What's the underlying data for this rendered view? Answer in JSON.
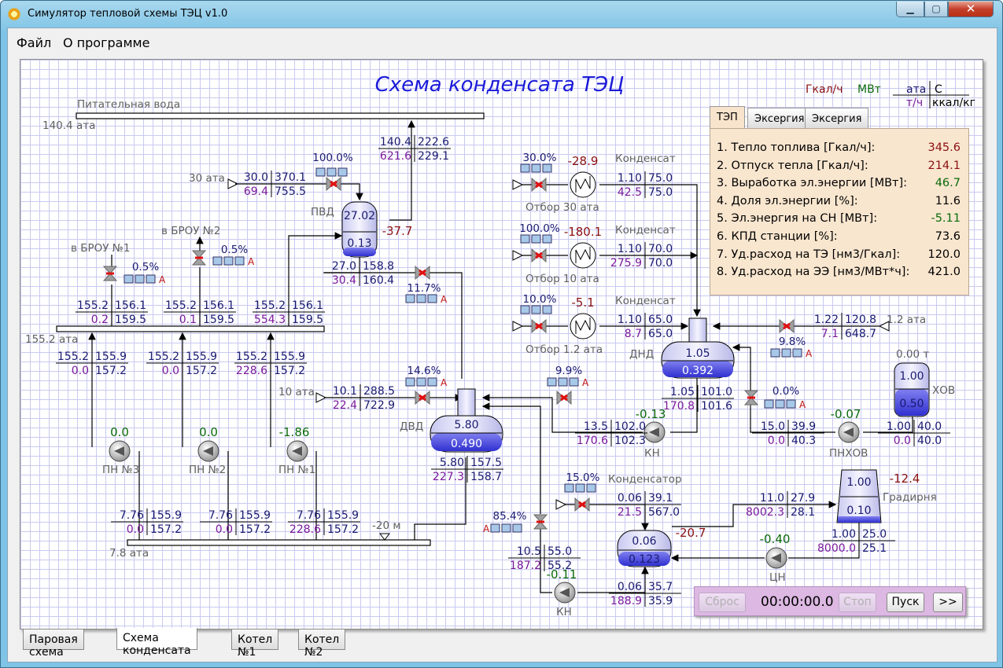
{
  "window": {
    "title": "Симулятор тепловой схемы ТЭЦ v1.0",
    "min": "▁",
    "max": "▢",
    "close": "✕"
  },
  "menu": [
    "Файл",
    "О программе"
  ],
  "diagram": {
    "title": "Схема конденсата ТЭЦ",
    "units": {
      "gcal": "Гкал/ч",
      "mw": "МВт",
      "ata": "ата",
      "c": "С",
      "th": "т/ч",
      "kcal": "ккал/кг"
    },
    "labels": {
      "feed_water": "Питательная вода",
      "p140": "140.4 ата",
      "p30": "30 ата",
      "pvd": "ПВД",
      "brou1": "в БРОУ №1",
      "brou2": "в БРОУ №2",
      "p155": "155.2 ата",
      "p10": "10 ата",
      "dvd": "ДВД",
      "pn3": "ПН №3",
      "pn2": "ПН №2",
      "pn1": "ПН №1",
      "p78": "7.8 ата",
      "m20": "-20 м",
      "cond_a": "Конденсат",
      "cond_b": "Конденсат",
      "cond_c": "Конденсат",
      "otb30": "Отбор 30 ата",
      "otb10": "Отбор 10 ата",
      "otb12": "Отбор 1.2 ата",
      "dnd": "ДНД",
      "kn1": "КН",
      "kn2": "КН",
      "p12": "1.2 ата",
      "hov": "ХОВ",
      "t0": "0.00 т",
      "pnhov": "ПНХОВ",
      "condenser": "Конденсатор",
      "gradirnya": "Градирня",
      "cn": "ЦН",
      "A": "А"
    },
    "values": {
      "v_100a": "100.0%",
      "v_30a": "30.0",
      "v_370": "370.1",
      "v_694": "69.4",
      "v_755": "755.5",
      "v_1404": "140.4",
      "v_2226": "222.6",
      "v_6216": "621.6",
      "v_2291": "229.1",
      "pvd_top": "27.02",
      "pvd_bot": "0.13",
      "v_m377": "-37.7",
      "v_270": "27.0",
      "v_1588": "158.8",
      "v_304": "30.4",
      "v_1604": "160.4",
      "v_117": "11.7%",
      "v_05a": "0.5%",
      "v_05b": "0.5%",
      "h1a": "155.2",
      "h1b": "156.1",
      "h1c": "0.2",
      "h1d": "159.5",
      "h2a": "155.2",
      "h2b": "156.1",
      "h2c": "0.1",
      "h2d": "159.5",
      "h3a": "155.2",
      "h3b": "156.1",
      "h3c": "554.3",
      "h3d": "159.5",
      "g1a": "155.2",
      "g1b": "155.9",
      "g1c": "0.0",
      "g1d": "157.2",
      "g2a": "155.2",
      "g2b": "155.9",
      "g2c": "0.0",
      "g2d": "157.2",
      "g3a": "155.2",
      "g3b": "155.9",
      "g3c": "228.6",
      "g3d": "157.2",
      "pn3v": "0.0",
      "pn2v": "0.0",
      "pn1v": "-1.86",
      "b1a": "7.76",
      "b1b": "155.9",
      "b1c": "0.0",
      "b1d": "157.2",
      "b2a": "7.76",
      "b2b": "155.9",
      "b2c": "0.0",
      "b2d": "157.2",
      "b3a": "7.76",
      "b3b": "155.9",
      "b3c": "228.6",
      "b3d": "157.2",
      "v_101": "10.1",
      "v_2885": "288.5",
      "v_224": "22.4",
      "v_7229": "722.9",
      "v_146": "14.6%",
      "dvd_top": "5.80",
      "dvd_bot": "0.490",
      "d_a": "5.80",
      "d_b": "157.5",
      "d_c": "227.3",
      "d_d": "158.7",
      "o30p": "30.0%",
      "o30q": "-28.9",
      "o10p": "100.0%",
      "o10q": "-180.1",
      "o12p": "10.0%",
      "o12q": "-5.1",
      "c1a": "1.10",
      "c1b": "75.0",
      "c1c": "42.5",
      "c1d": "75.0",
      "c2a": "1.10",
      "c2b": "70.0",
      "c2c": "275.9",
      "c2d": "70.0",
      "c3a": "1.10",
      "c3b": "65.0",
      "c3c": "8.7",
      "c3d": "65.0",
      "dnd_top": "1.05",
      "dnd_bot": "0.392",
      "n_a": "1.05",
      "n_b": "101.0",
      "n_c": "170.8",
      "n_d": "101.6",
      "r_a": "1.22",
      "r_b": "120.8",
      "r_c": "7.1",
      "r_d": "648.7",
      "v_98": "9.8%",
      "v_00": "0.0%",
      "v_99": "9.9%",
      "k_a": "13.5",
      "k_b": "102.0",
      "k_c": "170.6",
      "k_d": "102.3",
      "kn1v": "-0.13",
      "q_a": "15.0",
      "q_b": "39.9",
      "q_c": "0.0",
      "q_d": "40.3",
      "pnhovv": "-0.07",
      "hov_top": "1.00",
      "hov_bot": "0.50",
      "w_a": "1.00",
      "w_b": "40.0",
      "w_c": "0.0",
      "w_d": "40.0",
      "v_150": "15.0%",
      "s_a": "0.06",
      "s_b": "39.1",
      "s_c": "21.5",
      "s_d": "567.0",
      "v_854": "85.4%",
      "gr_top": "1.00",
      "gr_bot": "0.10",
      "grq": "-12.4",
      "u_a": "11.0",
      "u_b": "27.9",
      "u_c": "8002.3",
      "u_d": "28.1",
      "cond_top": "0.06",
      "cond_bot": "0.123",
      "condq": "-20.7",
      "cnv": "-0.40",
      "x_a": "1.00",
      "x_b": "25.0",
      "x_c": "8000.0",
      "x_d": "25.1",
      "y_a": "10.5",
      "y_b": "55.0",
      "y_c": "187.2",
      "y_d": "55.2",
      "kn2v": "-0.11",
      "z_a": "0.06",
      "z_b": "35.7",
      "z_c": "188.9",
      "z_d": "35.9"
    }
  },
  "tep": {
    "tabs": [
      "ТЭП",
      "Эксергия",
      "Эксергия"
    ],
    "rows": [
      {
        "label": "1. Тепло топлива [Гкал/ч]:",
        "value": "345.6",
        "color": "#8a1010"
      },
      {
        "label": "2. Отпуск тепла [Гкал/ч]:",
        "value": "214.1",
        "color": "#8a1010"
      },
      {
        "label": "3. Выработка эл.энергии [МВт]:",
        "value": "46.7",
        "color": "#0a6a0a"
      },
      {
        "label": "4. Доля эл.энергии [%]:",
        "value": "11.6",
        "color": "#000000"
      },
      {
        "label": "5. Эл.энергия на СН [МВт]:",
        "value": "-5.11",
        "color": "#0a6a0a"
      },
      {
        "label": "6. КПД станции [%]:",
        "value": "73.6",
        "color": "#000000"
      },
      {
        "label": "7. Уд.расход на ТЭ [нм3/Гкал]:",
        "value": "120.0",
        "color": "#000000"
      },
      {
        "label": "8. Уд.расход на ЭЭ [нм3/МВт*ч]:",
        "value": "421.0",
        "color": "#000000"
      }
    ]
  },
  "controls": {
    "reset": "Сброс",
    "timer": "00:00:00.0",
    "stop": "Стоп",
    "start": "Пуск",
    "fast": ">>"
  },
  "bottom_tabs": [
    "Паровая схема",
    "Схема конденсата",
    "Котел №1",
    "Котел №2"
  ]
}
